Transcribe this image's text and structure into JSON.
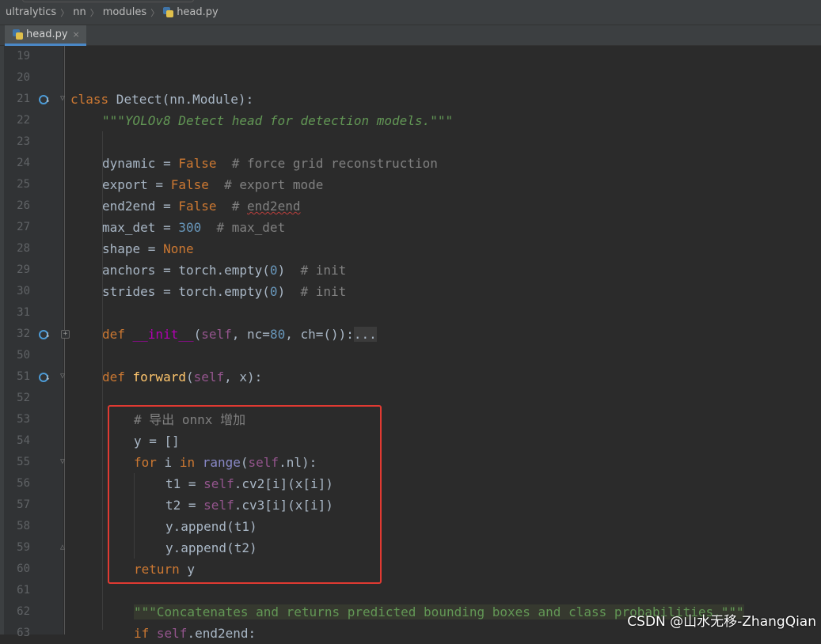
{
  "breadcrumb": {
    "items": [
      "ultralytics",
      "nn",
      "modules",
      "head.py"
    ]
  },
  "editor": {
    "tab": {
      "label": "head.py",
      "close": "×"
    },
    "line_numbers": [
      "19",
      "20",
      "21",
      "22",
      "23",
      "24",
      "25",
      "26",
      "27",
      "28",
      "29",
      "30",
      "31",
      "32",
      "50",
      "51",
      "52",
      "53",
      "54",
      "55",
      "56",
      "57",
      "58",
      "59",
      "60",
      "61",
      "62",
      "63"
    ],
    "code": {
      "l21": {
        "class_kw": "class",
        "name": " Detect(nn.Module):"
      },
      "l22": "\"\"\"YOLOv8 Detect head for detection models.\"\"\"",
      "l24": {
        "a": "dynamic = ",
        "b": "False",
        "c": "  # force grid reconstruction"
      },
      "l25": {
        "a": "export = ",
        "b": "False",
        "c": "  # export mode"
      },
      "l26": {
        "a": "end2end = ",
        "b": "False",
        "c": "  # ",
        "d": "end2end"
      },
      "l27": {
        "a": "max_det = ",
        "b": "300",
        "c": "  # max_det"
      },
      "l28": {
        "a": "shape = ",
        "b": "None"
      },
      "l29": {
        "a": "anchors = torch.empty(",
        "b": "0",
        "c": ")",
        "d": "  # init"
      },
      "l30": {
        "a": "strides = torch.empty(",
        "b": "0",
        "c": ")",
        "d": "  # init"
      },
      "l32": {
        "def": "def ",
        "name": "__init__",
        "p1": "(",
        "self": "self",
        "p2": ", nc=",
        "num": "80",
        "p3": ", ch=()):",
        "fold": "..."
      },
      "l51": {
        "def": "def ",
        "name": "forward",
        "p1": "(",
        "self": "self",
        "p2": ", x):"
      },
      "l53": "# 导出 onnx 增加",
      "l54": "y = []",
      "l55": {
        "for": "for",
        "i": " i ",
        "in": "in",
        "sp": " ",
        "range": "range",
        "p1": "(",
        "self": "self",
        "p2": ".nl):"
      },
      "l56": {
        "a": "t1 = ",
        "self": "self",
        "b": ".cv2[i](x[i])"
      },
      "l57": {
        "a": "t2 = ",
        "self": "self",
        "b": ".cv3[i](x[i])"
      },
      "l58": "y.append(t1)",
      "l59": "y.append(t2)",
      "l60": {
        "kw": "return",
        "v": " y"
      },
      "l62": "\"\"\"Concatenates and returns predicted bounding boxes and class probabilities.\"\"\"",
      "l63": {
        "kw": "if",
        "sp": " ",
        "self": "self",
        "rest": ".end2end:"
      }
    }
  },
  "watermark": "CSDN @山水无移-ZhangQian",
  "colors": {
    "background": "#2b2b2b",
    "keyword": "#cc7832",
    "self": "#94558d",
    "number": "#6897bb",
    "function": "#ffc66d",
    "docstring": "#629755",
    "comment": "#808080",
    "highlight_box": "#e03a32"
  }
}
